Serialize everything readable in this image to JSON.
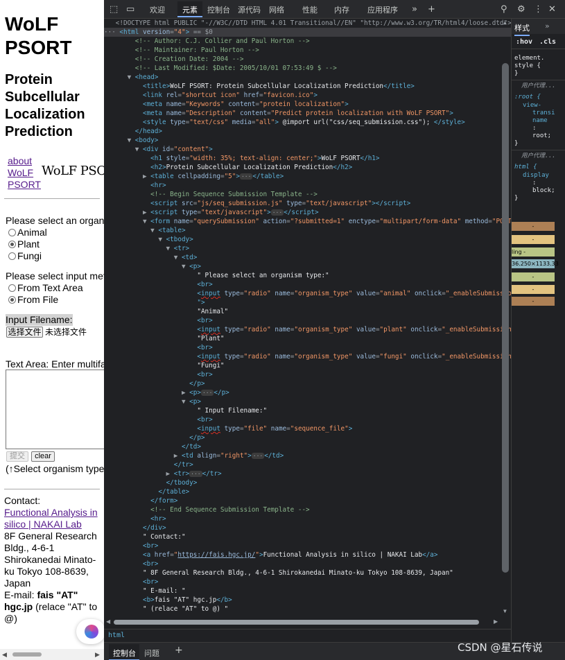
{
  "page": {
    "h1": "WoLF PSORT",
    "h2": "Protein Subcellular Localization Prediction",
    "nav": [
      "about",
      "WoLF",
      "PSORT"
    ],
    "logo_text": "WoLF PSORT",
    "organism_prompt": "Please select an organism type:",
    "organisms": [
      {
        "label": "Animal",
        "checked": false
      },
      {
        "label": "Plant",
        "checked": true
      },
      {
        "label": "Fungi",
        "checked": false
      }
    ],
    "input_prompt": "Please select input method:",
    "input_methods": [
      {
        "label": "From Text Area",
        "checked": false
      },
      {
        "label": "From File",
        "checked": true
      }
    ],
    "input_filename_label": "Input Filename:",
    "file_button": "选择文件",
    "file_none": "未选择文件",
    "textarea_label": "Text Area: Enter multifasta",
    "submit_button": "提交",
    "clear_button": "clear",
    "hint": "(↑Select organism type",
    "contact_label": "Contact:",
    "contact_link": "Functional Analysis in silico | NAKAI Lab",
    "address": "8F General Research Bldg., 4-6-1 Shirokanedai Minato-ku Tokyo 108-8639, Japan",
    "email_prefix": "E-mail:",
    "email_bold": "fais \"AT\" hgc.jp",
    "email_note": "(relace \"AT\" to @)"
  },
  "devtools": {
    "tabs": [
      "欢迎",
      "元素",
      "控制台",
      "源代码",
      "网络",
      "性能",
      "内存",
      "应用程序"
    ],
    "active_tab": "元素",
    "side_tab": "样式",
    "filter_hov": ":hov",
    "filter_cls": ".cls",
    "breadcrumb": "html",
    "drawer_tabs": [
      "控制台",
      "问题"
    ],
    "selected_marker": "== $0",
    "styles_lines": [
      "element.",
      "style {",
      "}",
      "用户代理...",
      ":root {",
      "view-",
      "transi",
      "name",
      ":",
      "root;",
      "}",
      "用户代理...",
      "html {",
      "display",
      ":",
      "block;",
      "}"
    ],
    "box_model": [
      "-",
      "-",
      "ling  -",
      "36.250×1133.33",
      "-",
      "-",
      "-"
    ]
  },
  "watermark": "CSDN @星石传说"
}
